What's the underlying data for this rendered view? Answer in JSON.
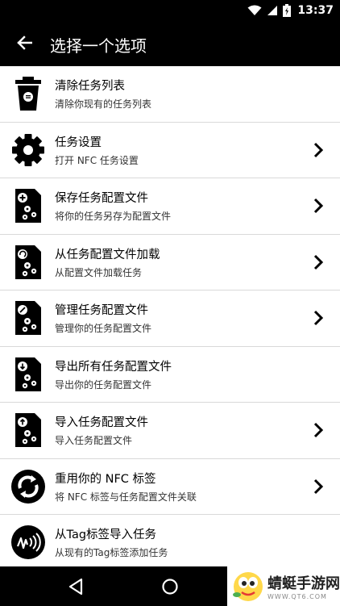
{
  "status_bar": {
    "time": "13:37",
    "icons": [
      "wifi-icon",
      "signal-icon",
      "battery-icon"
    ]
  },
  "toolbar": {
    "back_icon": "arrow-left-icon",
    "title": "选择一个选项"
  },
  "items": [
    {
      "title": "清除任务列表",
      "subtitle": "清除你现有的任务列表",
      "icon": "trash-icon",
      "chevron": false
    },
    {
      "title": "任务设置",
      "subtitle": "打开 NFC 任务设置",
      "icon": "gear-icon",
      "chevron": true
    },
    {
      "title": "保存任务配置文件",
      "subtitle": "将你的任务另存为配置文件",
      "icon": "save-profile-icon",
      "chevron": true
    },
    {
      "title": "从任务配置文件加载",
      "subtitle": "从配置文件加载任务",
      "icon": "load-profile-icon",
      "chevron": true
    },
    {
      "title": "管理任务配置文件",
      "subtitle": "管理你的任务配置文件",
      "icon": "manage-profile-icon",
      "chevron": true
    },
    {
      "title": "导出所有任务配置文件",
      "subtitle": "导出你的任务配置文件",
      "icon": "export-profile-icon",
      "chevron": false
    },
    {
      "title": "导入任务配置文件",
      "subtitle": "导入任务配置文件",
      "icon": "import-profile-icon",
      "chevron": true
    },
    {
      "title": "重用你的 NFC 标签",
      "subtitle": "将 NFC 标签与任务配置文件关联",
      "icon": "recycle-nfc-icon",
      "chevron": true
    },
    {
      "title": "从Tag标签导入任务",
      "subtitle": "从现有的Tag标签添加任务",
      "icon": "nfc-tag-icon",
      "chevron": false
    }
  ],
  "watermark": {
    "name": "蜻蜓手游网",
    "url": "WWW.QT6.COM"
  },
  "colors": {
    "bar_background": "#000000",
    "list_background": "#ffffff",
    "divider": "#d9d9d9"
  }
}
